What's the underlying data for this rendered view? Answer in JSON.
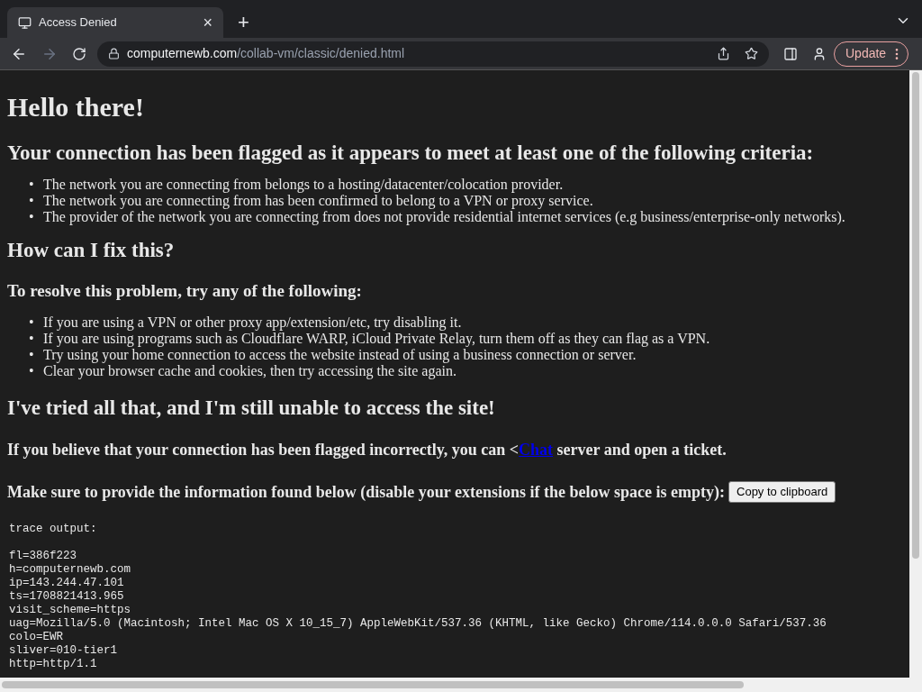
{
  "tab": {
    "title": "Access Denied",
    "close": "×",
    "new_tab": "+"
  },
  "address": {
    "domain": "computernewb.com",
    "path": "/collab-vm/classic/denied.html"
  },
  "update_button": "Update",
  "page": {
    "title": "Hello there!",
    "bullet": "•",
    "criteria_heading": "Your connection has been flagged as it appears to meet at least one of the following criteria:",
    "criteria": [
      "The network you are connecting from belongs to a hosting/datacenter/colocation provider.",
      "The network you are connecting from has been confirmed to belong to a VPN or proxy service.",
      "The provider of the network you are connecting from does not provide residential internet services (e.g business/enterprise-only networks)."
    ],
    "fix_heading": "How can I fix this?",
    "resolve_heading": "To resolve this problem, try any of the following:",
    "steps": [
      "If you are using a VPN or other proxy app/extension/etc, try disabling it.",
      "If you are using programs such as Cloudflare WARP, iCloud Private Relay, turn them off as they can flag as a VPN.",
      "Try using your home connection to access the website instead of using a business connection or server.",
      "Clear your browser cache and cookies, then try accessing the site again."
    ],
    "still_heading": "I've tried all that, and I'm still unable to access the site!",
    "believe": {
      "before": "If you believe that your connection has been flagged incorrectly, you can <",
      "link": "Chat",
      "after": " server and open a ticket."
    },
    "provide": "Make sure to provide the information found below (disable your extensions if the below space is empty):",
    "copy_button": "Copy to clipboard",
    "trace_title": "trace output:",
    "trace": [
      "fl=386f223",
      "h=computernewb.com",
      "ip=143.244.47.101",
      "ts=1708821413.965",
      "visit_scheme=https",
      "uag=Mozilla/5.0 (Macintosh; Intel Mac OS X 10_15_7) AppleWebKit/537.36 (KHTML, like Gecko) Chrome/114.0.0.0 Safari/537.36",
      "colo=EWR",
      "sliver=010-tier1",
      "http=http/1.1"
    ]
  }
}
